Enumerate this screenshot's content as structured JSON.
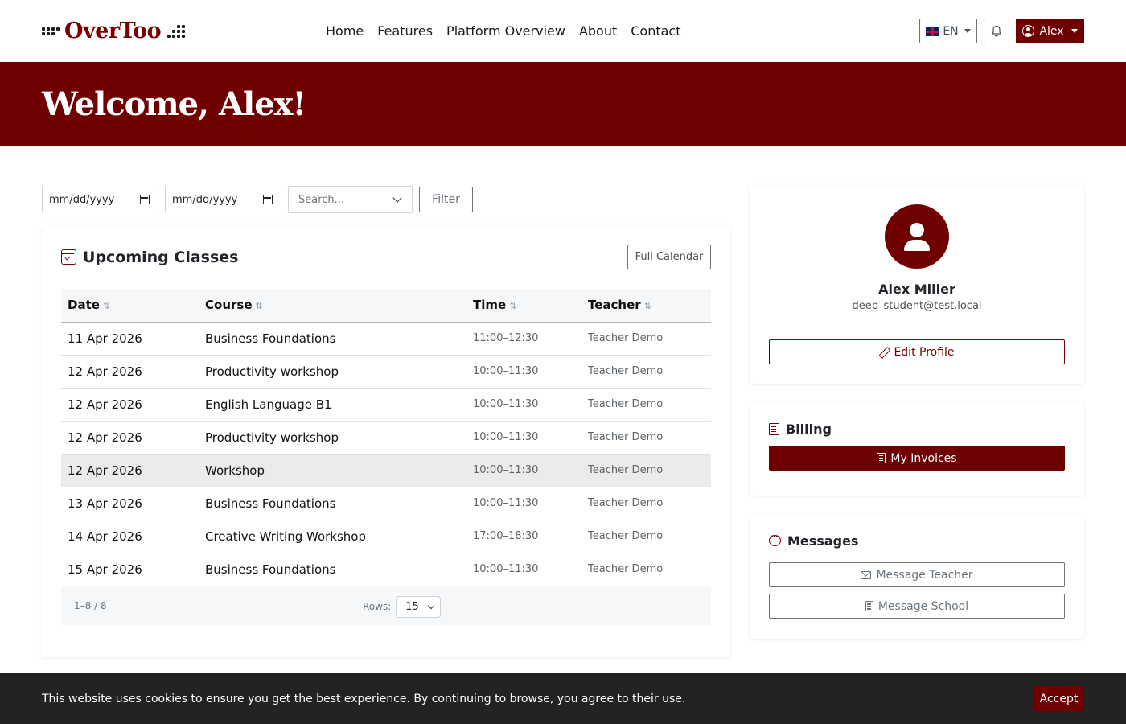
{
  "brand": {
    "name": "OverToo",
    "color": "#700000"
  },
  "nav": {
    "links": [
      "Home",
      "Features",
      "Platform Overview",
      "About",
      "Contact"
    ],
    "lang": "EN",
    "user": "Alex"
  },
  "hero": {
    "title": "Welcome, Alex!"
  },
  "filters": {
    "date_from": "mm/dd/yyyy",
    "date_to": "mm/dd/yyyy",
    "search_placeholder": "Search...",
    "filter_label": "Filter"
  },
  "classes": {
    "title": "Upcoming Classes",
    "full_calendar_label": "Full Calendar",
    "columns": [
      "Date",
      "Course",
      "Time",
      "Teacher"
    ],
    "rows": [
      {
        "date": "11 Apr 2026",
        "course": "Business Foundations",
        "time": "11:00–12:30",
        "teacher": "Teacher Demo"
      },
      {
        "date": "12 Apr 2026",
        "course": "Productivity workshop",
        "time": "10:00–11:30",
        "teacher": "Teacher Demo"
      },
      {
        "date": "12 Apr 2026",
        "course": "English Language B1",
        "time": "10:00–11:30",
        "teacher": "Teacher Demo"
      },
      {
        "date": "12 Apr 2026",
        "course": "Productivity workshop",
        "time": "10:00–11:30",
        "teacher": "Teacher Demo"
      },
      {
        "date": "12 Apr 2026",
        "course": "Workshop",
        "time": "10:00–11:30",
        "teacher": "Teacher Demo"
      },
      {
        "date": "13 Apr 2026",
        "course": "Business Foundations",
        "time": "10:00–11:30",
        "teacher": "Teacher Demo"
      },
      {
        "date": "14 Apr 2026",
        "course": "Creative Writing Workshop",
        "time": "17:00–18:30",
        "teacher": "Teacher Demo"
      },
      {
        "date": "15 Apr 2026",
        "course": "Business Foundations",
        "time": "10:00–11:30",
        "teacher": "Teacher Demo"
      }
    ],
    "pager": {
      "range": "1–8 / 8",
      "rows_label": "Rows:",
      "rows_value": "15"
    }
  },
  "profile": {
    "name": "Alex Miller",
    "email": "deep_student@test.local",
    "edit_label": "Edit Profile"
  },
  "billing": {
    "title": "Billing",
    "invoices_label": "My Invoices"
  },
  "messages": {
    "title": "Messages",
    "teacher_label": "Message Teacher",
    "school_label": "Message School"
  },
  "cookie": {
    "text": "This website uses cookies to ensure you get the best experience. By continuing to browse, you agree to their use.",
    "accept_label": "Accept"
  }
}
